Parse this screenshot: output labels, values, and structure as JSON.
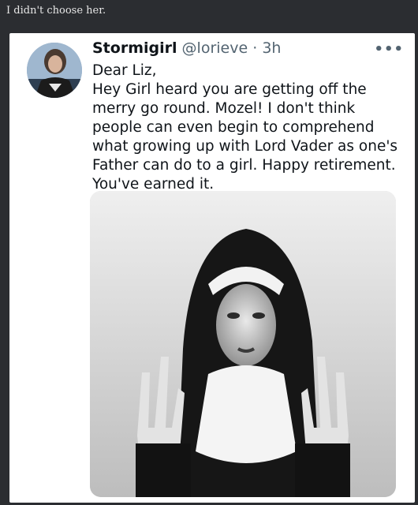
{
  "post": {
    "caption": "I didn't choose her."
  },
  "tweet": {
    "display_name": "Stormigirl",
    "handle": "@lorieve",
    "separator": "·",
    "time": "3h",
    "more_icon": "more-horizontal-icon",
    "lines": [
      "Dear Liz,",
      "Hey Girl heard you are getting off the merry go round. Mozel! I don't think people can even begin to comprehend what growing up with Lord Vader as one's Father can do to a girl. Happy retirement. You've earned it."
    ]
  },
  "colors": {
    "page_bg": "#2b2d31",
    "card_bg": "#ffffff",
    "text": "#0f1419",
    "muted": "#536471"
  }
}
